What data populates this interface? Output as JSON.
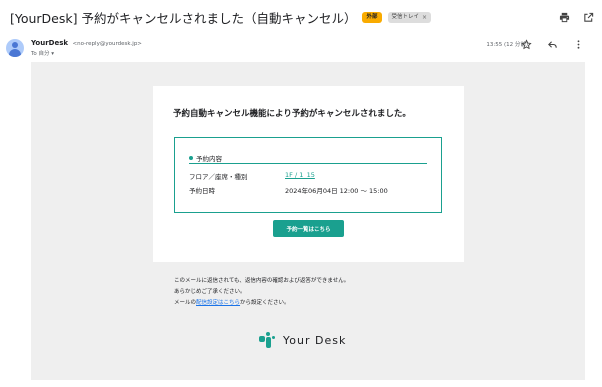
{
  "subject": {
    "title": "[YourDesk] 予約がキャンセルされました（自動キャンセル）",
    "chips": {
      "external": "外部",
      "inbox": "受信トレイ",
      "inbox_close": "×"
    }
  },
  "header_icons": {
    "print": "print-icon",
    "open_new": "open-in-new-icon"
  },
  "sender": {
    "name": "YourDesk",
    "email": "<no-reply@yourdesk.jp>",
    "to": "To 自分",
    "timestamp": "13:55 (12 分前)"
  },
  "sender_icons": {
    "star": "star-icon",
    "reply": "reply-icon",
    "more": "more-vert-icon"
  },
  "card": {
    "title": "予約自動キャンセル機能により予約がキャンセルされました。",
    "section_title": "予約内容",
    "rows": [
      {
        "label": "フロア／座席・種別",
        "value": "1F / 1_15"
      },
      {
        "label": "予約日時",
        "value": "2024年06月04日 12:00 ～ 15:00"
      }
    ],
    "button_label": "予約一覧はこちら"
  },
  "footer": {
    "line1": "このメールに返信されても、返信内容の確認および返答ができません。",
    "line2": "あらかじめご了承ください。",
    "line3_pre": "メールの",
    "line3_link": "配信設定はこちら",
    "line3_post": "から設定ください。"
  },
  "brand": {
    "name": "Your Desk"
  },
  "colors": {
    "accent": "#1aa08f",
    "chip_external": "#f9ab00",
    "link": "#1a73e8",
    "body_bg": "#efefef"
  }
}
